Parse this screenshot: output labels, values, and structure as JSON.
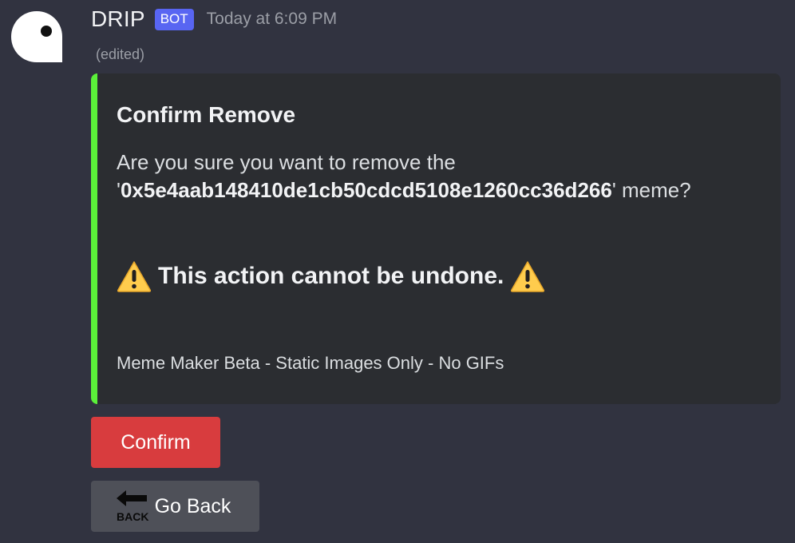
{
  "author": {
    "name": "DRIP",
    "badge": "BOT",
    "timestamp": "Today at 6:09 PM",
    "edited": "(edited)",
    "avatar_icon": "ghost-avatar-icon"
  },
  "embed": {
    "accent_color": "#5bf03a",
    "title": "Confirm Remove",
    "desc_line1": "Are you sure you want to remove the",
    "desc_quote_open": "'",
    "desc_meme_id": "0x5e4aab148410de1cb50cdcd5108e1260cc36d266",
    "desc_quote_close": "' meme?",
    "warning_text": "This action cannot be undone.",
    "warning_icon": "warning-icon",
    "footer": "Meme Maker Beta - Static Images Only - No GIFs"
  },
  "buttons": {
    "confirm_label": "Confirm",
    "confirm_color": "#d83c3e",
    "back_label": "Go Back",
    "back_icon": "back-arrow-icon",
    "back_icon_text": "BACK",
    "back_color": "#4e5058"
  }
}
